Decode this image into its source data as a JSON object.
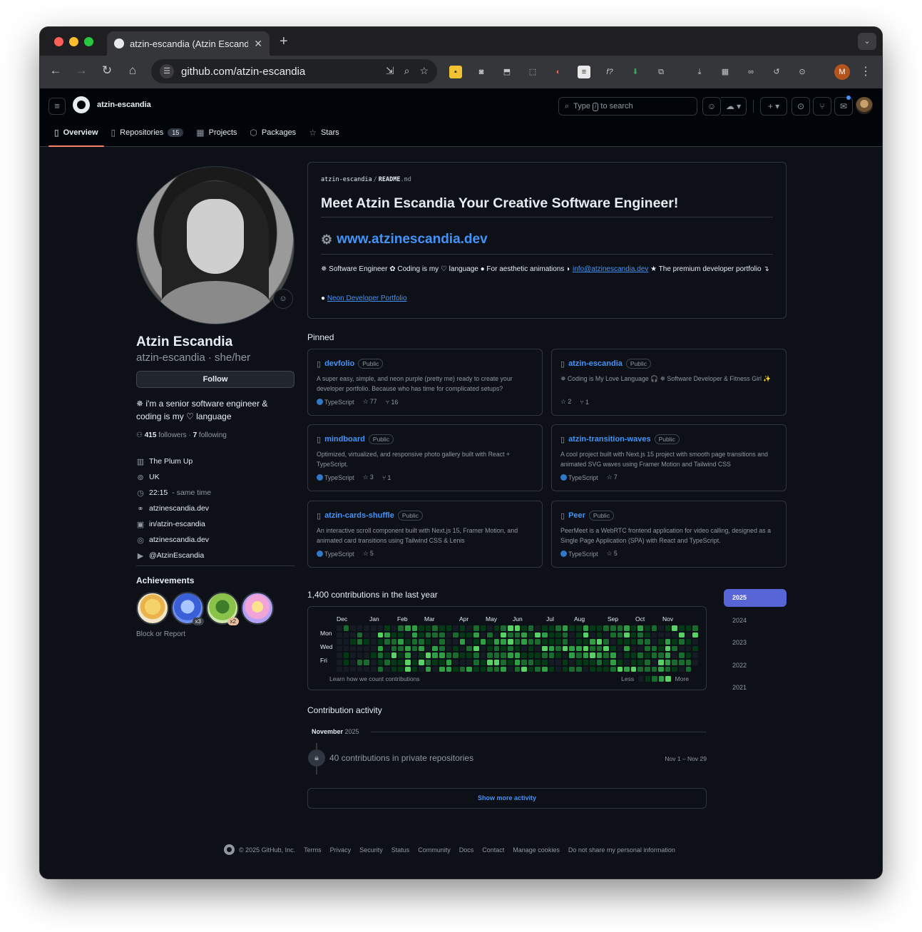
{
  "browser": {
    "tab_title": "atzin-escandia (Atzin Escandia)",
    "tab_close": "✕",
    "new_tab": "+",
    "url": "github.com/atzin-escandia",
    "profile_initial": "M"
  },
  "header": {
    "username": "atzin-escandia",
    "search_prefix": "Type",
    "search_key": "/",
    "search_suffix": "to search",
    "tabs": [
      {
        "label": "Overview",
        "icon": "book-icon"
      },
      {
        "label": "Repositories",
        "icon": "repo-icon",
        "count": "15"
      },
      {
        "label": "Projects",
        "icon": "table-icon"
      },
      {
        "label": "Packages",
        "icon": "package-icon"
      },
      {
        "label": "Stars",
        "icon": "star-icon"
      }
    ]
  },
  "profile": {
    "name": "Atzin Escandia",
    "login_line": "atzin-escandia · she/her",
    "follow_label": "Follow",
    "bio": "✵ i'm a senior software engineer & coding is my ♡ language",
    "followers_count": "415",
    "followers_label": "followers",
    "following_count": "7",
    "following_label": "following",
    "company": "The Plum Up",
    "location": "UK",
    "time": "22:15",
    "time_note": "- same time",
    "website": "atzinescandia.dev",
    "linkedin": "in/atzin-escandia",
    "social": "atzinescandia.dev",
    "youtube": "@AtzinEscandia",
    "achievements_title": "Achievements",
    "achievements": [
      {
        "name": "starstruck",
        "mult": ""
      },
      {
        "name": "pull-shark",
        "mult": "x3"
      },
      {
        "name": "pair-extraordinaire",
        "mult": "x2"
      },
      {
        "name": "yolo",
        "mult": ""
      }
    ],
    "block_report": "Block or Report"
  },
  "readme": {
    "path_user": "atzin-escandia",
    "path_sep": "/",
    "path_file": "README",
    "path_ext": ".md",
    "heading": "Meet Atzin Escandia Your Creative Software Engineer!",
    "website_heading": "www.atzinescandia.dev",
    "para_start": "✵ Software Engineer ✿ Coding is my ♡ language ● For aesthetic animations ◗",
    "email": "info@atzinescandia.dev",
    "para_end": "★ The premium developer portfolio ↴",
    "link_bullet": "●",
    "link_text": "Neon Developer Portfolio"
  },
  "pinned": {
    "title": "Pinned",
    "public_label": "Public",
    "items": [
      {
        "name": "devfolio",
        "desc": "A super easy, simple, and neon purple (pretty me) ready to create your developer portfolio. Because who has time for complicated setups?",
        "lang": "TypeScript",
        "stars": "77",
        "forks": "16"
      },
      {
        "name": "atzin-escandia",
        "desc": "✵ Coding is My Love Language 🎧 ✵ Software Developer & Fitness Girl ✨",
        "lang": "",
        "stars": "2",
        "forks": "1"
      },
      {
        "name": "mindboard",
        "desc": "Optimized, virtualized, and responsive photo gallery built with React + TypeScript.",
        "lang": "TypeScript",
        "stars": "3",
        "forks": "1"
      },
      {
        "name": "atzin-transition-waves",
        "desc": "A cool project built with Next.js 15 project with smooth page transitions and animated SVG waves using Framer Motion and Tailwind CSS",
        "lang": "TypeScript",
        "stars": "7",
        "forks": ""
      },
      {
        "name": "atzin-cards-shuffle",
        "desc": "An interactive scroll component built with Next.js 15, Framer Motion, and animated card transitions using Tailwind CSS & Lenis",
        "lang": "TypeScript",
        "stars": "5",
        "forks": ""
      },
      {
        "name": "Peer",
        "desc": "PeerMeet is a WebRTC frontend application for video calling, designed as a Single Page Application (SPA) with React and TypeScript.",
        "lang": "TypeScript",
        "stars": "5",
        "forks": ""
      }
    ]
  },
  "contributions": {
    "title": "1,400 contributions in the last year",
    "months": [
      "Dec",
      "Jan",
      "Feb",
      "Mar",
      "Apr",
      "May",
      "Jun",
      "Jul",
      "Aug",
      "Sep",
      "Oct",
      "Nov"
    ],
    "days": [
      "Mon",
      "Wed",
      "Fri"
    ],
    "learn": "Learn how we count contributions",
    "less": "Less",
    "more": "More",
    "level_colors": [
      "#151b23",
      "#033a16",
      "#196c2e",
      "#2ea043",
      "#56d364"
    ],
    "years": [
      "2025",
      "2024",
      "2023",
      "2022",
      "2021"
    ]
  },
  "activity": {
    "title": "Contribution activity",
    "month": "November",
    "year": "2025",
    "item": "40 contributions in private repositories",
    "range": "Nov 1 – Nov 29",
    "show_more": "Show more activity"
  },
  "footer": {
    "copyright": "© 2025 GitHub, Inc.",
    "links": [
      "Terms",
      "Privacy",
      "Security",
      "Status",
      "Community",
      "Docs",
      "Contact",
      "Manage cookies",
      "Do not share my personal information"
    ]
  },
  "colors": {
    "link": "#4493f8",
    "accent_underline": "#f78166",
    "year_active": "#5865d6"
  }
}
